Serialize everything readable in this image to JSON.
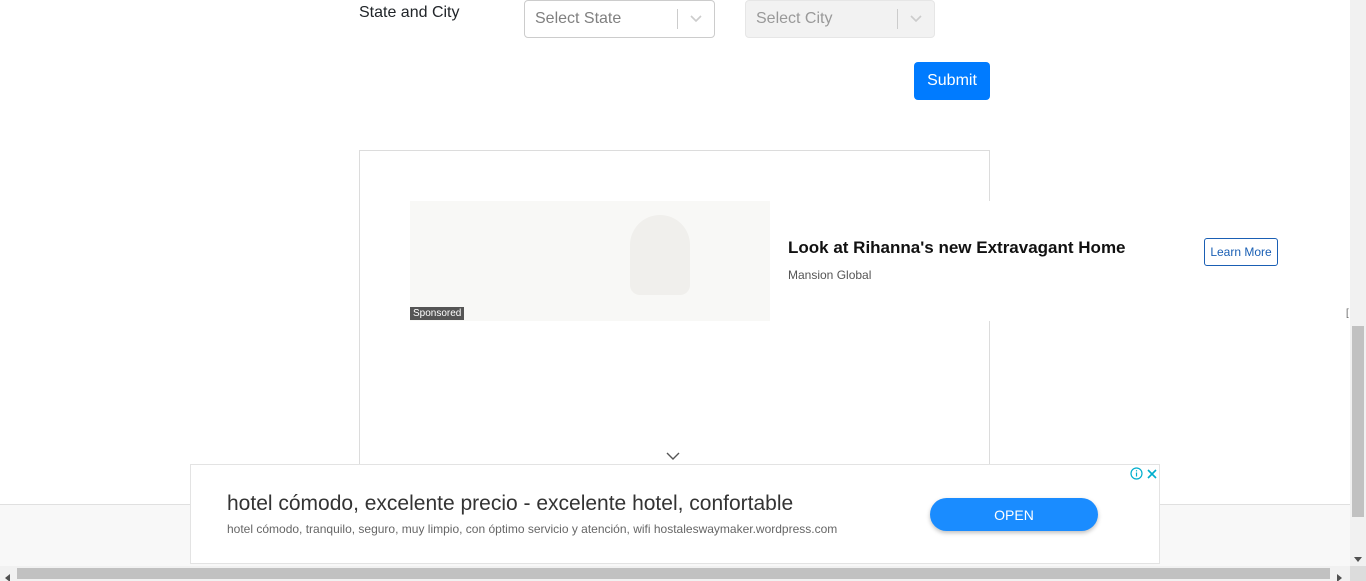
{
  "form": {
    "state_city_label": "State and City",
    "state_placeholder": "Select State",
    "city_placeholder": "Select City",
    "submit_label": "Submit"
  },
  "sponsored_ad": {
    "badge": "Sponsored",
    "title": "Look at Rihanna's new Extravagant Home",
    "source": "Mansion Global",
    "cta_label": "Learn More"
  },
  "bottom_ad": {
    "headline": "hotel cómodo, excelente precio - excelente hotel, confortable",
    "description": "hotel cómodo, tranquilo, seguro, muy limpio, con óptimo servicio y atención, wifi hostaleswaymaker.wordpress.com",
    "cta_label": "OPEN"
  },
  "colors": {
    "primary": "#007bff",
    "open_button": "#1a8cff",
    "learn_more": "#1a5fb4"
  },
  "icons": {
    "select_arrow": "chevron-down-icon",
    "expand": "chevron-down-icon",
    "adchoices": "info-icon",
    "close": "close-icon"
  }
}
